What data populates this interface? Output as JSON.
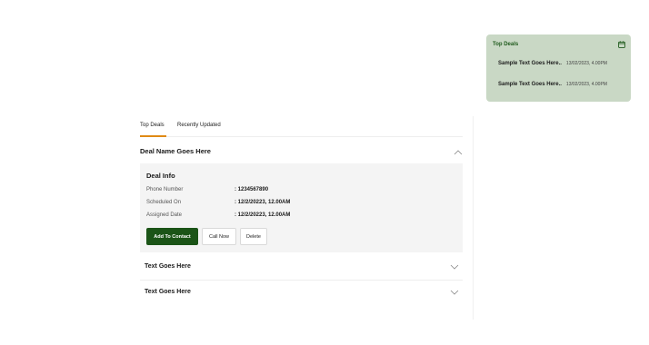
{
  "widget": {
    "title": "Top Deals",
    "calendar_icon": "calendar-icon",
    "items": [
      {
        "text": "Sample Text Goes Here..",
        "date": "13/02/2023, 4.00PM"
      },
      {
        "text": "Sample Text Goes Here..",
        "date": "13/02/2023, 4.00PM"
      }
    ]
  },
  "tabs": [
    {
      "label": "Top Deals",
      "active": true
    },
    {
      "label": "Recently Updated",
      "active": false
    }
  ],
  "deal": {
    "title": "Deal Name Goes Here",
    "info_title": "Deal Info",
    "fields": [
      {
        "label": "Phone Number",
        "value": ": 1234567890"
      },
      {
        "label": "Scheduled On",
        "value": ": 12/2/20223, 12.00AM"
      },
      {
        "label": "Assigned Date",
        "value": ": 12/2/20223, 12.00AM"
      }
    ],
    "buttons": {
      "add": "Add To Contact",
      "call": "Call Now",
      "delete": "Delete"
    }
  },
  "accordion": [
    {
      "label": "Text Goes Here"
    },
    {
      "label": "Text Goes Here"
    }
  ],
  "colors": {
    "widget_bg": "#c9d8c5",
    "accent": "#1b5417",
    "tab_underline": "#e08a14"
  }
}
